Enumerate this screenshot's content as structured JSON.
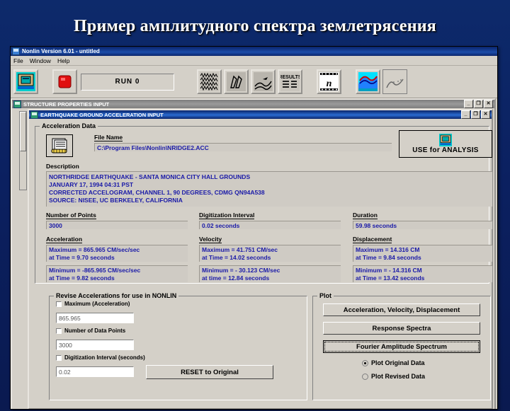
{
  "slide": {
    "title": "Пример амплитудного спектра землетрясения"
  },
  "app": {
    "title": "Nonlin Version 6.01 - untitled",
    "menu": [
      "File",
      "Window",
      "Help"
    ],
    "win_controls": {
      "minimize": "_",
      "restore": "❐",
      "close": "✕"
    },
    "toolbar": {
      "run_label": "RUN 0",
      "buttons": [
        "structure-icon",
        "stop-icon",
        "acceleration-record-icon",
        "hysteresis-icon",
        "time-history-icon",
        "results-icon",
        "animation-icon",
        "spectrum-color-icon",
        "response-spectra-icon"
      ]
    }
  },
  "structure_window": {
    "title": "STRUCTURE PROPERTIES INPUT"
  },
  "eq_window": {
    "title": "EARTHQUAKE GROUND ACCELERATION INPUT",
    "accel_data": {
      "legend": "Acceleration Data",
      "file_name_label": "File Name",
      "file_name_value": "C:\\Program Files\\Nonlin\\NRIDGE2.ACC",
      "use_for_analysis": "USE for ANALYSIS",
      "description_label": "Description",
      "description_lines": [
        "NORTHRIDGE EARTHQUAKE - SANTA MONICA CITY HALL GROUNDS",
        "JANUARY 17, 1994 04:31 PST",
        "CORRECTED ACCELOGRAM, CHANNEL 1, 90 DEGREES, CDMG QN94A538",
        "SOURCE: NISEE, UC BERKELEY, CALIFORNIA"
      ],
      "points_label": "Number of Points",
      "points_value": "3000",
      "interval_label": "Digitization Interval",
      "interval_value": "0.02 seconds",
      "duration_label": "Duration",
      "duration_value": "59.98 seconds",
      "acceleration": {
        "label": "Acceleration",
        "max_line1": "Maximum =  865.965 CM/sec/sec",
        "max_line2": "at Time =  9.70   seconds",
        "min_line1": "Minimum = -865.965 CM/sec/sec",
        "min_line2": "at Time =  9.82   seconds"
      },
      "velocity": {
        "label": "Velocity",
        "max_line1": "Maximum =  41.751 CM/sec",
        "max_line2": "at Time =  14.02  seconds",
        "min_line1": "Minimum = - 30.123 CM/sec",
        "min_line2": "at time =  12.84  seconds"
      },
      "displacement": {
        "label": "Displacement",
        "max_line1": "Maximum =  14.316 CM",
        "max_line2": "at Time =  9.84   seconds",
        "min_line1": "Minimum = - 14.316 CM",
        "min_line2": "at Time =  13.42  seconds"
      }
    },
    "revise": {
      "legend": "Revise Accelerations for use in NONLIN",
      "max_accel_label": "Maximum (Acceleration)",
      "max_accel_value": "865.965",
      "num_points_label": "Number of Data Points",
      "num_points_value": "3000",
      "interval_label": "Digitization Interval (seconds)",
      "interval_value": "0.02",
      "reset_button": "RESET to Original"
    },
    "plot": {
      "legend": "Plot",
      "buttons": [
        "Acceleration, Velocity, Displacement",
        "Response Spectra",
        "Fourier Amplitude Spectrum"
      ],
      "radios": [
        {
          "label": "Plot Original Data",
          "selected": true
        },
        {
          "label": "Plot Revised Data",
          "selected": false
        }
      ]
    }
  }
}
